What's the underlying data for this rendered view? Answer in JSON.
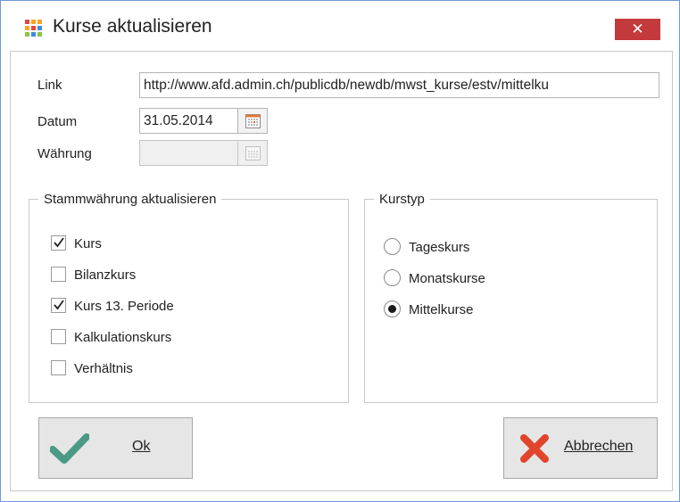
{
  "window": {
    "title": "Kurse aktualisieren",
    "close_glyph": "✕"
  },
  "form": {
    "link_label": "Link",
    "link_value": "http://www.afd.admin.ch/publicdb/newdb/mwst_kurse/estv/mittelku",
    "datum_label": "Datum",
    "datum_value": "31.05.2014",
    "waehrung_label": "Währung",
    "waehrung_value": ""
  },
  "stammwaehrung": {
    "legend": "Stammwährung aktualisieren",
    "items": [
      {
        "label": "Kurs",
        "checked": true
      },
      {
        "label": "Bilanzkurs",
        "checked": false
      },
      {
        "label": "Kurs 13. Periode",
        "checked": true
      },
      {
        "label": "Kalkulationskurs",
        "checked": false
      },
      {
        "label": "Verhältnis",
        "checked": false
      }
    ]
  },
  "kurstyp": {
    "legend": "Kurstyp",
    "options": [
      {
        "label": "Tageskurs",
        "selected": false
      },
      {
        "label": "Monatskurse",
        "selected": false
      },
      {
        "label": "Mittelkurse",
        "selected": true
      }
    ]
  },
  "buttons": {
    "ok_label": "Ok",
    "cancel_label": "Abbrechen"
  },
  "icons": {
    "app": "grid-app-icon",
    "calendar": "calendar-icon",
    "ok": "check-icon",
    "cancel": "cross-icon",
    "close": "close-icon"
  },
  "colors": {
    "close_bg": "#c4393c",
    "ok_check": "#4a9a86",
    "cancel_x": "#e0452b",
    "window_border": "#6f9ad6"
  }
}
